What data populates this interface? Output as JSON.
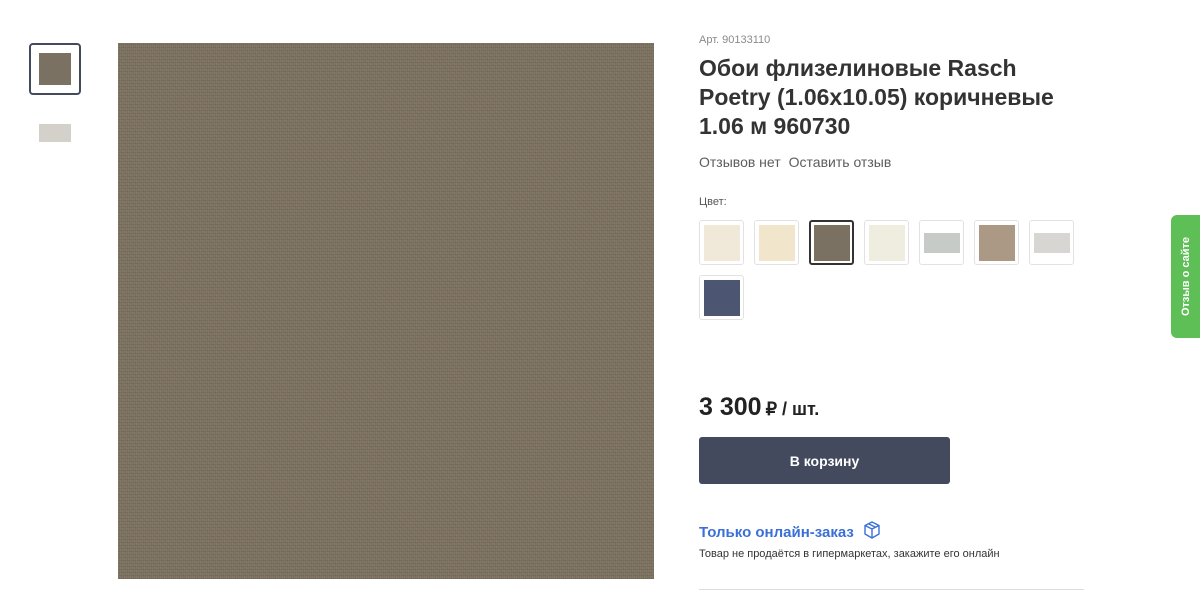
{
  "gallery": {
    "thumbnails": [
      {
        "color": "#7a7163",
        "active": true
      },
      {
        "color": "#d4d1cb",
        "active": false
      }
    ],
    "main_image_color": "#7d7260"
  },
  "product": {
    "article": "Арт. 90133110",
    "title": "Обои флизелиновые Rasch Poetry (1.06x10.05) коричневые 1.06 м 960730",
    "reviews_count_text": "Отзывов нет",
    "leave_review": "Оставить отзыв"
  },
  "color_selector": {
    "label": "Цвет:",
    "swatches": [
      {
        "color": "#f0e9da",
        "selected": false
      },
      {
        "color": "#f1e5cc",
        "selected": false
      },
      {
        "color": "#7a7163",
        "selected": true
      },
      {
        "color": "#efeddf",
        "selected": false
      },
      {
        "color": "#c6cbc7",
        "selected": false
      },
      {
        "color": "#ab9985",
        "selected": false
      },
      {
        "color": "#d8d6d3",
        "selected": false
      },
      {
        "color": "#4c5672",
        "selected": false
      }
    ]
  },
  "price": {
    "amount": "3 300",
    "unit": "₽ / шт."
  },
  "cart": {
    "button_label": "В корзину"
  },
  "online_only": {
    "label": "Только онлайн-заказ",
    "icon": "box-icon",
    "accent": "#3b6fd8",
    "note": "Товар не продаётся в гипермаркетах, закажите его онлайн"
  },
  "feedback": {
    "label": "Отзыв о сайте",
    "color": "#5fbf57"
  }
}
